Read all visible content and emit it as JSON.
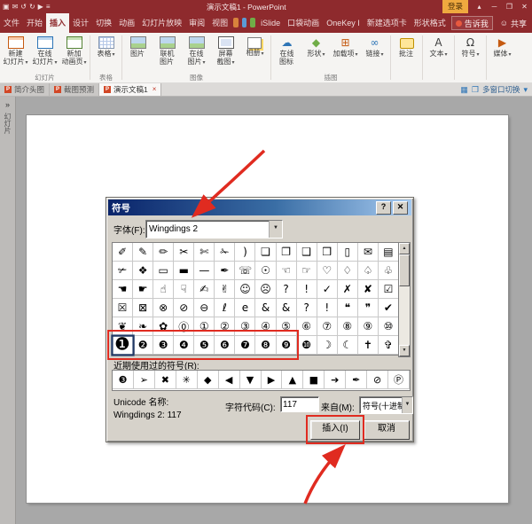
{
  "window": {
    "title": "演示文稿1 - PowerPoint",
    "login": "登录"
  },
  "icons": {
    "save": "▣",
    "mail": "✉",
    "undo": "↺",
    "redo": "↻",
    "play": "▶",
    "menu": "≡",
    "ribbon_options": "▴",
    "minimize": "─",
    "restore": "❐",
    "close": "✕",
    "dropdown": "▾",
    "dropdown_small": "▼",
    "up": "▲",
    "down": "▼",
    "cloud": "☁",
    "shapes": "◆",
    "addins": "⊞",
    "link": "∞",
    "text": "A",
    "symbol": "Ω",
    "media": "▶",
    "person": "☺",
    "grid": "▦",
    "window": "❐",
    "help": "?"
  },
  "tabs": [
    "文件",
    "开始",
    "插入",
    "设计",
    "切换",
    "动画",
    "幻灯片放映",
    "审阅",
    "视图",
    "iSlide",
    "口袋动画",
    "OneKey I",
    "新建选项卡",
    "形状格式"
  ],
  "tellme": "告诉我",
  "share": "共享",
  "ribbon": {
    "groups": [
      {
        "label": "幻灯片",
        "buttons": [
          {
            "label": "新建 幻灯片",
            "arrow": "▾"
          },
          {
            "label": "在线 幻灯片",
            "arrow": "▾"
          },
          {
            "label": "新加 动画页",
            "arrow": "▾"
          }
        ]
      },
      {
        "label": "表格",
        "buttons": [
          {
            "label": "表格",
            "arrow": "▾"
          }
        ]
      },
      {
        "label": "图像",
        "buttons": [
          {
            "label": "图片",
            "arrow": ""
          },
          {
            "label": "联机 图片",
            "arrow": ""
          },
          {
            "label": "在线 图片",
            "arrow": "▾"
          },
          {
            "label": "屏幕 截图",
            "arrow": "▾"
          },
          {
            "label": "相册",
            "arrow": "▾"
          }
        ]
      },
      {
        "label": "插图",
        "buttons": [
          {
            "label": "在线 图标",
            "arrow": ""
          },
          {
            "label": "形状",
            "arrow": "▾"
          },
          {
            "label": "加载项",
            "arrow": "▾"
          },
          {
            "label": "链接",
            "arrow": "▾"
          }
        ]
      },
      {
        "label": "",
        "buttons": [
          {
            "label": "批注",
            "arrow": ""
          }
        ]
      },
      {
        "label": "",
        "buttons": [
          {
            "label": "文本",
            "arrow": "▾"
          }
        ]
      },
      {
        "label": "",
        "buttons": [
          {
            "label": "符号",
            "arrow": "▾"
          }
        ]
      },
      {
        "label": "",
        "buttons": [
          {
            "label": "媒体",
            "arrow": "▾"
          }
        ]
      }
    ]
  },
  "doc_tabs": {
    "tabs": [
      {
        "label": "简介头图"
      },
      {
        "label": "截图预测"
      },
      {
        "label": "演示文稿1"
      }
    ],
    "file_letter": "P",
    "close_glyph": "×",
    "right_label": "多窗口切换"
  },
  "panel": {
    "chevrons": "»",
    "vertical_label": "幻灯片"
  },
  "dialog": {
    "title": "符号",
    "font_label": "字体(F):",
    "font_value": "Wingdings 2",
    "grid_glyphs": [
      "✐",
      "✎",
      "✏",
      "✂",
      "✄",
      "✁",
      ")",
      "❏",
      "❐",
      "❑",
      "❒",
      "▯",
      "✉",
      "▤",
      "✃",
      "❖",
      "▭",
      "▬",
      "—",
      "✒",
      "☏",
      "☉",
      "☜",
      "☞",
      "♡",
      "♢",
      "♤",
      "♧",
      "☚",
      "☛",
      "☝",
      "☟",
      "✍",
      "✌",
      "☺",
      "☹",
      "?",
      "!",
      "✓",
      "✗",
      "✘",
      "☑",
      "☒",
      "⊠",
      "⊗",
      "⊘",
      "⊖",
      "ℓ",
      "e",
      "&",
      "&",
      "?",
      "!",
      "❝",
      "❞",
      "✔",
      "❦",
      "❧",
      "✿",
      "⓪",
      "①",
      "②",
      "③",
      "④",
      "⑤",
      "⑥",
      "⑦",
      "⑧",
      "⑨",
      "⑩",
      "❶",
      "❷",
      "❸",
      "❹",
      "❺",
      "❻",
      "❼",
      "❽",
      "❾",
      "❿",
      "☽",
      "☾",
      "✝",
      "✞"
    ],
    "selected_index": 70,
    "recent_label": "近期使用过的符号(R):",
    "recent_glyphs": [
      "❸",
      "➢",
      "✖",
      "✳",
      "◆",
      "◀",
      "▼",
      "▶",
      "▲",
      "■",
      "➔",
      "✒",
      "⊘",
      "Ⓟ"
    ],
    "unicode_label": "Unicode 名称:",
    "unicode_value": "Wingdings 2: 117",
    "charcode_label": "字符代码(C):",
    "charcode_value": "117",
    "from_label": "来自(M):",
    "from_value": "符号(十进制)",
    "insert_label": "插入(I)",
    "cancel_label": "取消"
  },
  "colors": {
    "titlebar": "#8e2a2d",
    "login_bg": "#efa93f",
    "canvas": "#a8a8a8",
    "dialog_bg": "#d6d2ca",
    "dialog_title_start": "#0a246a",
    "dialog_title_end": "#a6caf0",
    "annotation_red": "#e02b20"
  }
}
